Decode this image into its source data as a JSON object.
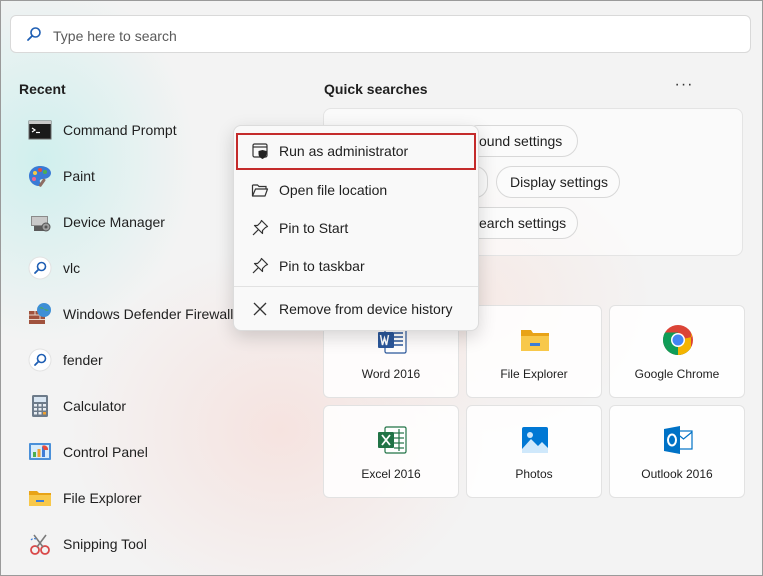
{
  "search": {
    "placeholder": "Type here to search"
  },
  "recent": {
    "title": "Recent",
    "items": [
      {
        "label": "Command Prompt",
        "icon": "command-prompt-icon"
      },
      {
        "label": "Paint",
        "icon": "paint-icon"
      },
      {
        "label": "Device Manager",
        "icon": "device-manager-icon"
      },
      {
        "label": "vlc",
        "icon": "search-result-icon"
      },
      {
        "label": "Windows Defender Firewall",
        "icon": "firewall-icon"
      },
      {
        "label": "fender",
        "icon": "search-result-icon"
      },
      {
        "label": "Calculator",
        "icon": "calculator-icon"
      },
      {
        "label": "Control Panel",
        "icon": "control-panel-icon"
      },
      {
        "label": "File Explorer",
        "icon": "folder-icon"
      },
      {
        "label": "Snipping Tool",
        "icon": "snipping-tool-icon"
      }
    ]
  },
  "quick_searches": {
    "title": "Quick searches",
    "more_label": "···",
    "pills": [
      "ound settings",
      "Display settings",
      "earch settings"
    ]
  },
  "top_apps": [
    {
      "label": "Word 2016",
      "icon": "word-icon",
      "color": "#2b579a"
    },
    {
      "label": "File Explorer",
      "icon": "folder-icon",
      "color": "#f6c342"
    },
    {
      "label": "Google Chrome",
      "icon": "chrome-icon",
      "color": "#db4437"
    },
    {
      "label": "Excel 2016",
      "icon": "excel-icon",
      "color": "#217346"
    },
    {
      "label": "Photos",
      "icon": "photos-icon",
      "color": "#0078d4"
    },
    {
      "label": "Outlook 2016",
      "icon": "outlook-icon",
      "color": "#0072c6"
    }
  ],
  "context_menu": {
    "items": [
      {
        "label": "Run as administrator",
        "icon": "shield-icon"
      },
      {
        "label": "Open file location",
        "icon": "folder-open-icon"
      },
      {
        "label": "Pin to Start",
        "icon": "pin-icon"
      },
      {
        "label": "Pin to taskbar",
        "icon": "pin-icon"
      },
      {
        "label": "Remove from device history",
        "icon": "close-icon"
      }
    ],
    "highlight_color": "#c42b2b"
  }
}
